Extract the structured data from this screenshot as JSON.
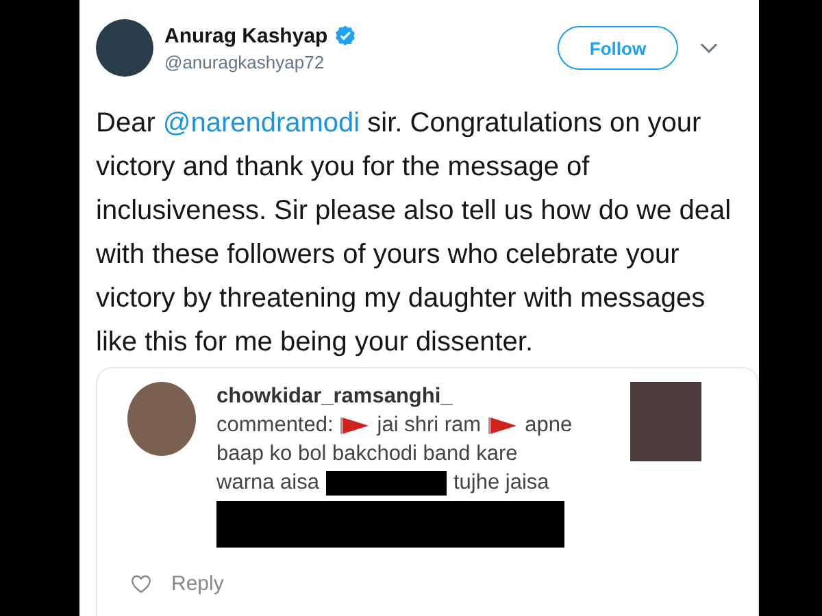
{
  "tweet": {
    "author": {
      "name": "Anurag Kashyap",
      "verified": true,
      "handle": "@anuragkashyap72"
    },
    "follow_button": "Follow",
    "body": [
      {
        "kind": "text",
        "text": "Dear "
      },
      {
        "kind": "mention",
        "text": "@narendramodi"
      },
      {
        "kind": "text",
        "text": " sir. Congratulations on your victory and thank you for the message of inclusiveness. Sir please also tell us how do we deal with these followers of yours who celebrate your victory by threatening my daughter with messages like this for me being your dissenter."
      }
    ],
    "quoted_comment": {
      "username": "chowkidar_ramsanghi_",
      "lines": [
        [
          {
            "kind": "text",
            "text": "commented:"
          },
          {
            "kind": "flag"
          },
          {
            "kind": "text",
            "text": "jai shri ram"
          },
          {
            "kind": "flag"
          },
          {
            "kind": "text",
            "text": "apne"
          }
        ],
        [
          {
            "kind": "text",
            "text": "baap ko bol bakchodi band kare"
          }
        ],
        [
          {
            "kind": "text",
            "text": "warna aisa"
          },
          {
            "kind": "redaction"
          },
          {
            "kind": "text",
            "text": "tujhe jaisa"
          }
        ],
        [
          {
            "kind": "redaction_block"
          }
        ]
      ],
      "reply": "Reply"
    }
  }
}
